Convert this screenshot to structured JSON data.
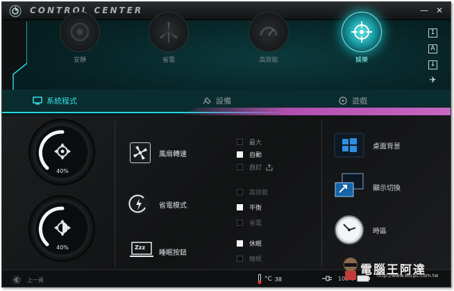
{
  "app": {
    "title": "CONTROL CENTER",
    "accent": "#27d8e0",
    "highlight": "#b04fae"
  },
  "window_controls": {
    "minimize": "—",
    "close": "✕"
  },
  "modes": [
    {
      "label": "安靜",
      "icon": "fan-icon"
    },
    {
      "label": "省電",
      "icon": "windmill-icon"
    },
    {
      "label": "高效能",
      "icon": "gauge-icon"
    },
    {
      "label": "娛樂",
      "icon": "target-icon",
      "active": true
    }
  ],
  "side_icons": [
    "1",
    "A",
    "↓",
    "✈"
  ],
  "tabs": [
    {
      "label": "系統程式",
      "active": true
    },
    {
      "label": "設備"
    },
    {
      "label": "遊戲"
    }
  ],
  "dials": [
    {
      "value_text": "40%",
      "level": 0.4,
      "icon": "crosshair-icon"
    },
    {
      "value_text": "40%",
      "level": 0.4,
      "icon": "brightness-icon"
    }
  ],
  "fan": {
    "label": "風扇轉速",
    "options": [
      {
        "label": "最大",
        "checked": false
      },
      {
        "label": "自動",
        "checked": true
      },
      {
        "label": "自訂",
        "checked": false
      }
    ]
  },
  "power": {
    "label": "省電模式",
    "options": [
      {
        "label": "高效能",
        "checked": false
      },
      {
        "label": "平衡",
        "checked": true
      },
      {
        "label": "省電",
        "checked": false
      }
    ]
  },
  "sleep": {
    "label": "睡眠按鈕",
    "icon_text": "Zzz",
    "options": [
      {
        "label": "休眠",
        "checked": true
      },
      {
        "label": "睡眠",
        "checked": false
      }
    ]
  },
  "tools": [
    {
      "label": "桌面背景",
      "icon": "desktop-icon"
    },
    {
      "label": "顯示切換",
      "icon": "display-switch-icon"
    },
    {
      "label": "時區",
      "icon": "clock-icon"
    }
  ],
  "status": {
    "back_label": "上一頁",
    "temperature": "38",
    "temp_unit": "°C",
    "battery": "100%"
  },
  "watermark": {
    "text": "電腦王阿達",
    "url": "http://www.kocpc.com.tw"
  }
}
